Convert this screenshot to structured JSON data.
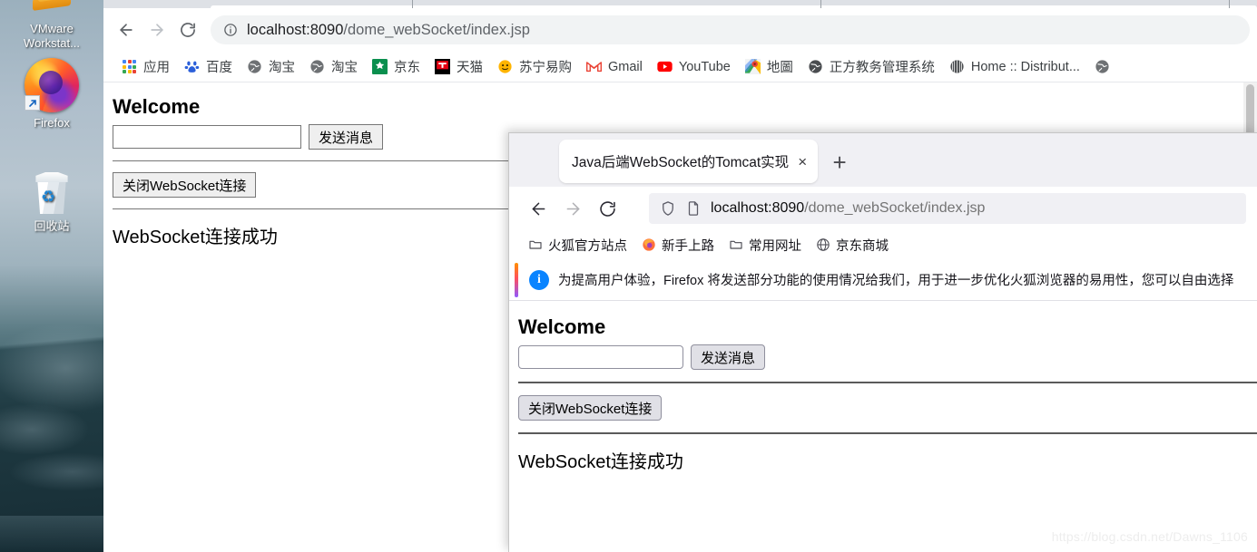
{
  "desktop": {
    "icons": [
      {
        "name": "VMware Workstat...",
        "icon": "vmware-icon"
      },
      {
        "name": "Firefox",
        "icon": "firefox-icon"
      },
      {
        "name": "回收站",
        "icon": "recycle-bin-icon"
      }
    ]
  },
  "chrome": {
    "toolbar": {
      "back": "back-icon",
      "forward": "forward-icon",
      "reload": "reload-icon",
      "site_info": "info-circle-icon",
      "url_host": "localhost:8090",
      "url_path": "/dome_webSocket/index.jsp"
    },
    "bookmarks": [
      {
        "label": "应用",
        "icon": "apps-grid-icon"
      },
      {
        "label": "百度",
        "icon": "baidu-paw-icon"
      },
      {
        "label": "淘宝",
        "icon": "globe-icon"
      },
      {
        "label": "淘宝",
        "icon": "globe-icon"
      },
      {
        "label": "京东",
        "icon": "jd-icon"
      },
      {
        "label": "天猫",
        "icon": "tmall-icon"
      },
      {
        "label": "苏宁易购",
        "icon": "suning-lion-icon"
      },
      {
        "label": "Gmail",
        "icon": "gmail-icon"
      },
      {
        "label": "YouTube",
        "icon": "youtube-icon"
      },
      {
        "label": "地圖",
        "icon": "google-maps-icon"
      },
      {
        "label": "正方教务管理系统",
        "icon": "globe-dark-icon"
      },
      {
        "label": "Home :: Distribut...",
        "icon": "sphere-icon"
      },
      {
        "label": "",
        "icon": "globe-icon"
      }
    ],
    "page": {
      "heading": "Welcome",
      "input_value": "",
      "input_placeholder": "",
      "send_button": "发送消息",
      "close_button": "关闭WebSocket连接",
      "status_message": "WebSocket连接成功"
    }
  },
  "firefox": {
    "tab": {
      "title": "Java后端WebSocket的Tomcat实现",
      "close": "×",
      "new_tab": "+"
    },
    "toolbar": {
      "back": "back-icon",
      "forward": "forward-icon",
      "reload": "reload-icon",
      "shield": "shield-icon",
      "page_icon": "page-icon",
      "url_host": "localhost:8090",
      "url_path": "/dome_webSocket/index.jsp"
    },
    "bookmarks": [
      {
        "label": "火狐官方站点",
        "icon": "folder-icon"
      },
      {
        "label": "新手上路",
        "icon": "firefox-icon"
      },
      {
        "label": "常用网址",
        "icon": "folder-icon"
      },
      {
        "label": "京东商城",
        "icon": "globe-outline-icon"
      }
    ],
    "notification": {
      "icon": "info-icon",
      "text": "为提高用户体验，Firefox 将发送部分功能的使用情况给我们，用于进一步优化火狐浏览器的易用性，您可以自由选择"
    },
    "page": {
      "heading": "Welcome",
      "input_value": "",
      "input_placeholder": "",
      "send_button": "发送消息",
      "close_button": "关闭WebSocket连接",
      "status_message": "WebSocket连接成功"
    }
  },
  "watermark": "https://blog.csdn.net/Dawns_1106"
}
